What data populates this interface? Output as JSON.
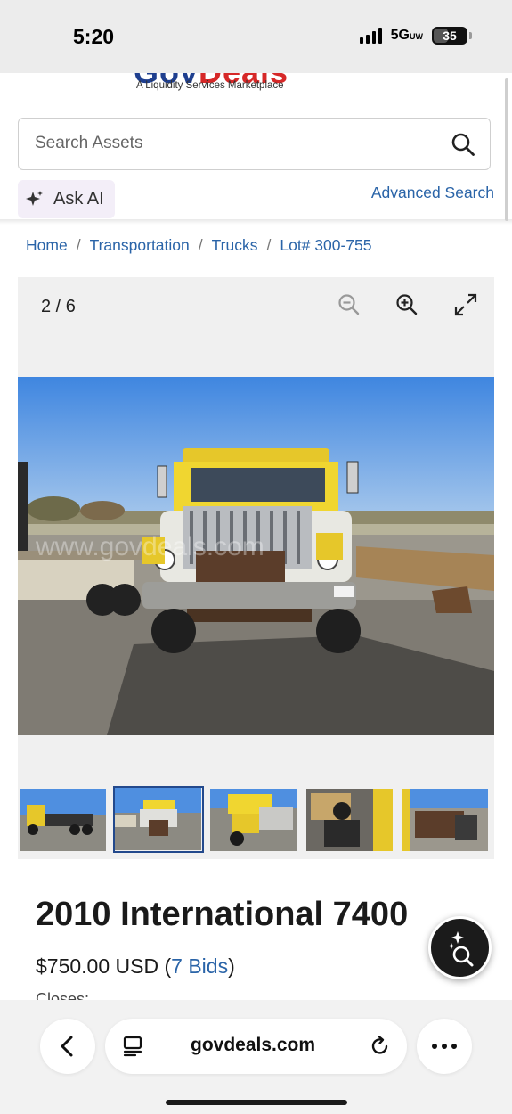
{
  "status_bar": {
    "time": "5:20",
    "network": "5G",
    "network_sub": "UW",
    "battery": "35"
  },
  "header": {
    "logo_gov": "Gov",
    "logo_deals": "Deals",
    "tagline": "A Liquidity Services Marketplace",
    "search": {
      "placeholder": "Search Assets",
      "value": ""
    },
    "ask_ai_label": "Ask AI",
    "advanced_search_label": "Advanced Search"
  },
  "breadcrumb": {
    "items": [
      "Home",
      "Transportation",
      "Trucks",
      "Lot# 300-755"
    ],
    "separator": "/"
  },
  "gallery": {
    "counter": "2 / 6",
    "current_index": 2,
    "total": 6,
    "icons": [
      "zoom-out-icon",
      "zoom-in-icon",
      "expand-icon"
    ],
    "thumbnails": [
      {
        "subject": "truck side view",
        "active": false
      },
      {
        "subject": "truck front view",
        "active": true
      },
      {
        "subject": "truck front angle",
        "active": false
      },
      {
        "subject": "cab interior",
        "active": false
      },
      {
        "subject": "truck rear bed",
        "active": false
      }
    ],
    "watermark": "www.govdeals.com"
  },
  "listing": {
    "title": "2010 International 7400",
    "price": "$750.00 USD",
    "bids_open": "(",
    "bids": "7 Bids",
    "bids_close": ")",
    "next_label_partial": "Closes:"
  },
  "browser": {
    "url": "govdeals.com",
    "icons": [
      "back-chevron-icon",
      "tabs-icon",
      "reload-icon",
      "more-icon"
    ]
  },
  "colors": {
    "link": "#2a64a8",
    "brand_blue": "#1f3f8f",
    "brand_red": "#d62828",
    "active_thumb_border": "#23498c",
    "gallery_bg": "#f0f0f0"
  }
}
